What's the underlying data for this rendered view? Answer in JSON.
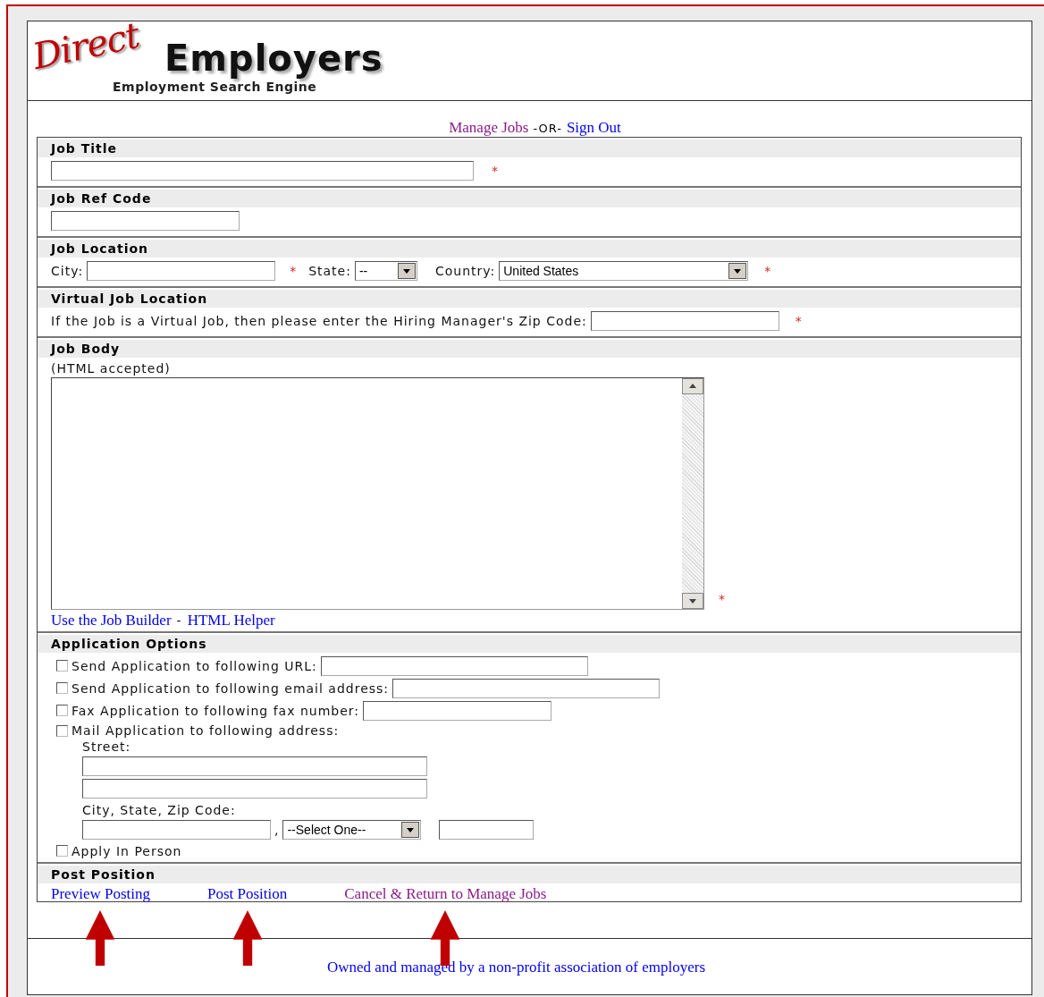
{
  "logo": {
    "script_word": "Direct",
    "word": "Employers",
    "tagline": "Employment Search Engine"
  },
  "top_links": [
    {
      "text": "Manage Jobs",
      "visited": true
    },
    {
      "text": "Sign Out",
      "visited": false
    }
  ],
  "top_separator": "-OR-",
  "sections": [
    {
      "kind": "long_field",
      "title": "Job Title",
      "required_mark": "*"
    },
    {
      "kind": "short_field",
      "title": "Job Ref Code"
    },
    {
      "kind": "location",
      "title": "Job Location",
      "city_label": "City:",
      "city_required_mark": "*",
      "state_label": "State:",
      "state_value": "--",
      "country_label": "Country:",
      "country_value": "United States",
      "country_required_mark": "*"
    },
    {
      "kind": "virtual",
      "title": "Virtual Job Location",
      "prompt": "If the Job is a Virtual Job, then please enter the Hiring Manager's Zip Code:",
      "required_mark": "*"
    },
    {
      "kind": "body",
      "title": "Job Body",
      "note": "(HTML accepted)",
      "required_mark": "*",
      "links": [
        {
          "text": "Use the Job Builder"
        },
        {
          "text": "HTML Helper"
        }
      ],
      "link_separator": "-"
    },
    {
      "kind": "options",
      "title": "Application Options",
      "options": [
        {
          "kind": "field",
          "label": "Send Application to following URL:",
          "checked": false
        },
        {
          "kind": "field",
          "label": "Send Application to following email address:",
          "checked": false
        },
        {
          "kind": "short_field",
          "label": "Fax Application to following fax number:",
          "checked": false
        },
        {
          "kind": "address",
          "label": "Mail Application to following address:",
          "checked": false,
          "street_label": "Street:",
          "city_label": "City, State, Zip Code:",
          "comma": ",",
          "state_value": "--Select One--"
        },
        {
          "kind": "plain",
          "label": "Apply In Person",
          "checked": false
        }
      ]
    },
    {
      "kind": "actions",
      "title": "Post Position",
      "links": [
        {
          "text": "Preview Posting",
          "visited": false,
          "pointer_arrow": true
        },
        {
          "text": "Post Position",
          "visited": false,
          "pointer_arrow": true
        },
        {
          "text": "Cancel & Return to Manage Jobs",
          "visited": true,
          "pointer_arrow": true
        }
      ]
    }
  ],
  "footer": {
    "text": "Owned and managed by a non-profit association of employers"
  }
}
